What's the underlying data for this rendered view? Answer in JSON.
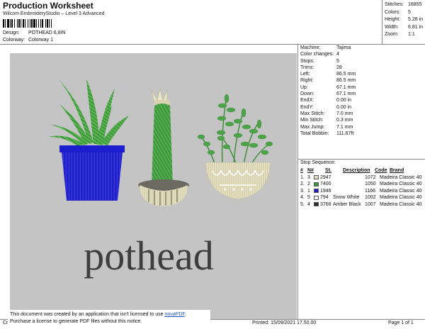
{
  "header": {
    "title": "Production Worksheet",
    "subtitle": "Wilcom EmbroideryStudio – Level 3 Advanced",
    "design_label": "Design:",
    "design_value": "POTHEAD 6,8IN",
    "colorway_label": "Colorway:",
    "colorway_value": "Colorway 1"
  },
  "summary": [
    {
      "label": "Stitches:",
      "value": "16855"
    },
    {
      "label": "Colors:",
      "value": "5"
    },
    {
      "label": "Height:",
      "value": "5.28 in"
    },
    {
      "label": "Width:",
      "value": "6.81 in"
    },
    {
      "label": "Zoom:",
      "value": "1:1"
    }
  ],
  "specs": [
    {
      "label": "Machine:",
      "value": "Tajima"
    },
    {
      "label": "Color changes:",
      "value": "4"
    },
    {
      "label": "Stops:",
      "value": "5"
    },
    {
      "label": "Trims:",
      "value": "28"
    },
    {
      "label": "Left:",
      "value": "86.5 mm"
    },
    {
      "label": "Right:",
      "value": "86.5 mm"
    },
    {
      "label": "Up:",
      "value": "67.1 mm"
    },
    {
      "label": "Down:",
      "value": "67.1 mm"
    },
    {
      "label": "EndX:",
      "value": "0.00 in"
    },
    {
      "label": "EndY:",
      "value": "0.00 in"
    },
    {
      "label": "Max Stitch:",
      "value": "7.0 mm"
    },
    {
      "label": "Min Stitch:",
      "value": "0.3 mm"
    },
    {
      "label": "Max Jump:",
      "value": "7.1 mm"
    },
    {
      "label": "Total Bobbin:",
      "value": "111.67ft"
    }
  ],
  "stop_sequence": {
    "title": "Stop Sequence:",
    "headers": [
      "#",
      "N#",
      "St.",
      "Description",
      "Code",
      "Brand"
    ],
    "rows": [
      {
        "num": "1.",
        "n": "3",
        "color": "#e4dcc4",
        "st": "2947",
        "desc": "",
        "code": "1072",
        "brand": "Madeira Classic 40"
      },
      {
        "num": "2.",
        "n": "2",
        "color": "#3a9a3a",
        "st": "7400",
        "desc": "",
        "code": "1050",
        "brand": "Madeira Classic 40"
      },
      {
        "num": "3.",
        "n": "1",
        "color": "#1e1ec8",
        "st": "1946",
        "desc": "",
        "code": "1166",
        "brand": "Madeira Classic 40"
      },
      {
        "num": "4.",
        "n": "5",
        "color": "#f6f6f6",
        "st": "794",
        "desc": "Snow White",
        "code": "1002",
        "brand": "Madeira Classic 40"
      },
      {
        "num": "5.",
        "n": "4",
        "color": "#2c2c2c",
        "st": "3766",
        "desc": "Amber Black",
        "code": "1007",
        "brand": "Madeira Classic 40"
      }
    ]
  },
  "design_text": "pothead",
  "footer": {
    "notice_line1_prefix": "This document was created by an application that isn't licensed to use ",
    "notice_link": "novaPDF",
    "notice_line1_suffix": ".",
    "notice_line2": "Purchase a license to generate PDF files without this notice.",
    "cr": "Cr",
    "printed": "Printed: 15/09/2021 17.50.00",
    "page": "Page 1 of 1"
  }
}
